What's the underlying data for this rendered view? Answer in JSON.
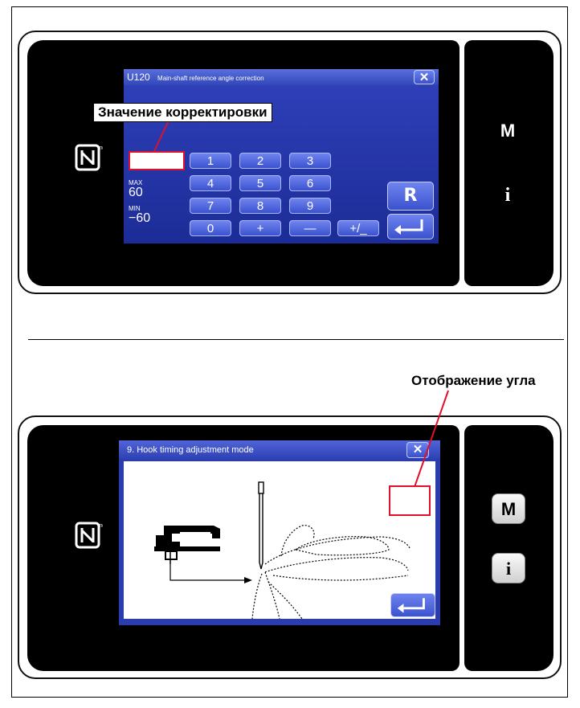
{
  "top_panel": {
    "dialog": {
      "code": "U120",
      "title": "Main-shaft reference angle correction",
      "close_icon": "close-icon"
    },
    "entry_value": "",
    "limits": {
      "max_label": "MAX",
      "max_value": "60",
      "min_label": "MIN",
      "min_value": "−60"
    },
    "keypad": [
      "1",
      "2",
      "3",
      "4",
      "5",
      "6",
      "7",
      "8",
      "9",
      "0",
      "+",
      "—",
      "+/_"
    ],
    "reset_label": "R",
    "enter_icon": "enter-arrow-icon",
    "side_buttons": {
      "m": "M",
      "i": "i"
    },
    "nfc_icon": "nfc-icon"
  },
  "callout_correction": "Значение корректировки",
  "caption_angle": "Отображение угла",
  "bottom_panel": {
    "dialog": {
      "title": "9. Hook timing adjustment mode",
      "close_icon": "close-icon"
    },
    "angle_value": "",
    "enter_icon": "enter-arrow-icon",
    "side_buttons": {
      "m": "M",
      "i": "i"
    },
    "nfc_icon": "nfc-icon"
  }
}
